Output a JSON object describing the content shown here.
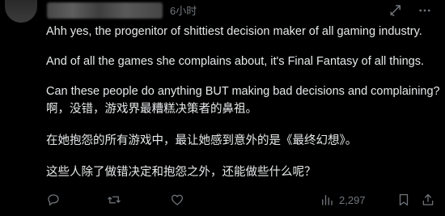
{
  "post": {
    "time": "6小时",
    "paragraphs": {
      "p1": "Ahh yes, the progenitor of shittiest decision maker of all gaming industry.",
      "p2": "And of all the games she complains about, it's Final Fantasy of all things.",
      "p3": "Can these people do anything BUT making bad decisions and complaining?",
      "p4": "啊，没错，游戏界最糟糕决策者的鼻祖。",
      "p5": "在她抱怨的所有游戏中，最让她感到意外的是《最终幻想》。",
      "p6": "这些人除了做错决定和抱怨之外，还能做些什么呢？"
    },
    "header_icons": [
      "grok-icon",
      "more-icon"
    ],
    "actions": {
      "views_count": "2,297"
    }
  },
  "colors": {
    "background": "#000000",
    "text": "#e7e9ea",
    "muted": "#71767b"
  }
}
